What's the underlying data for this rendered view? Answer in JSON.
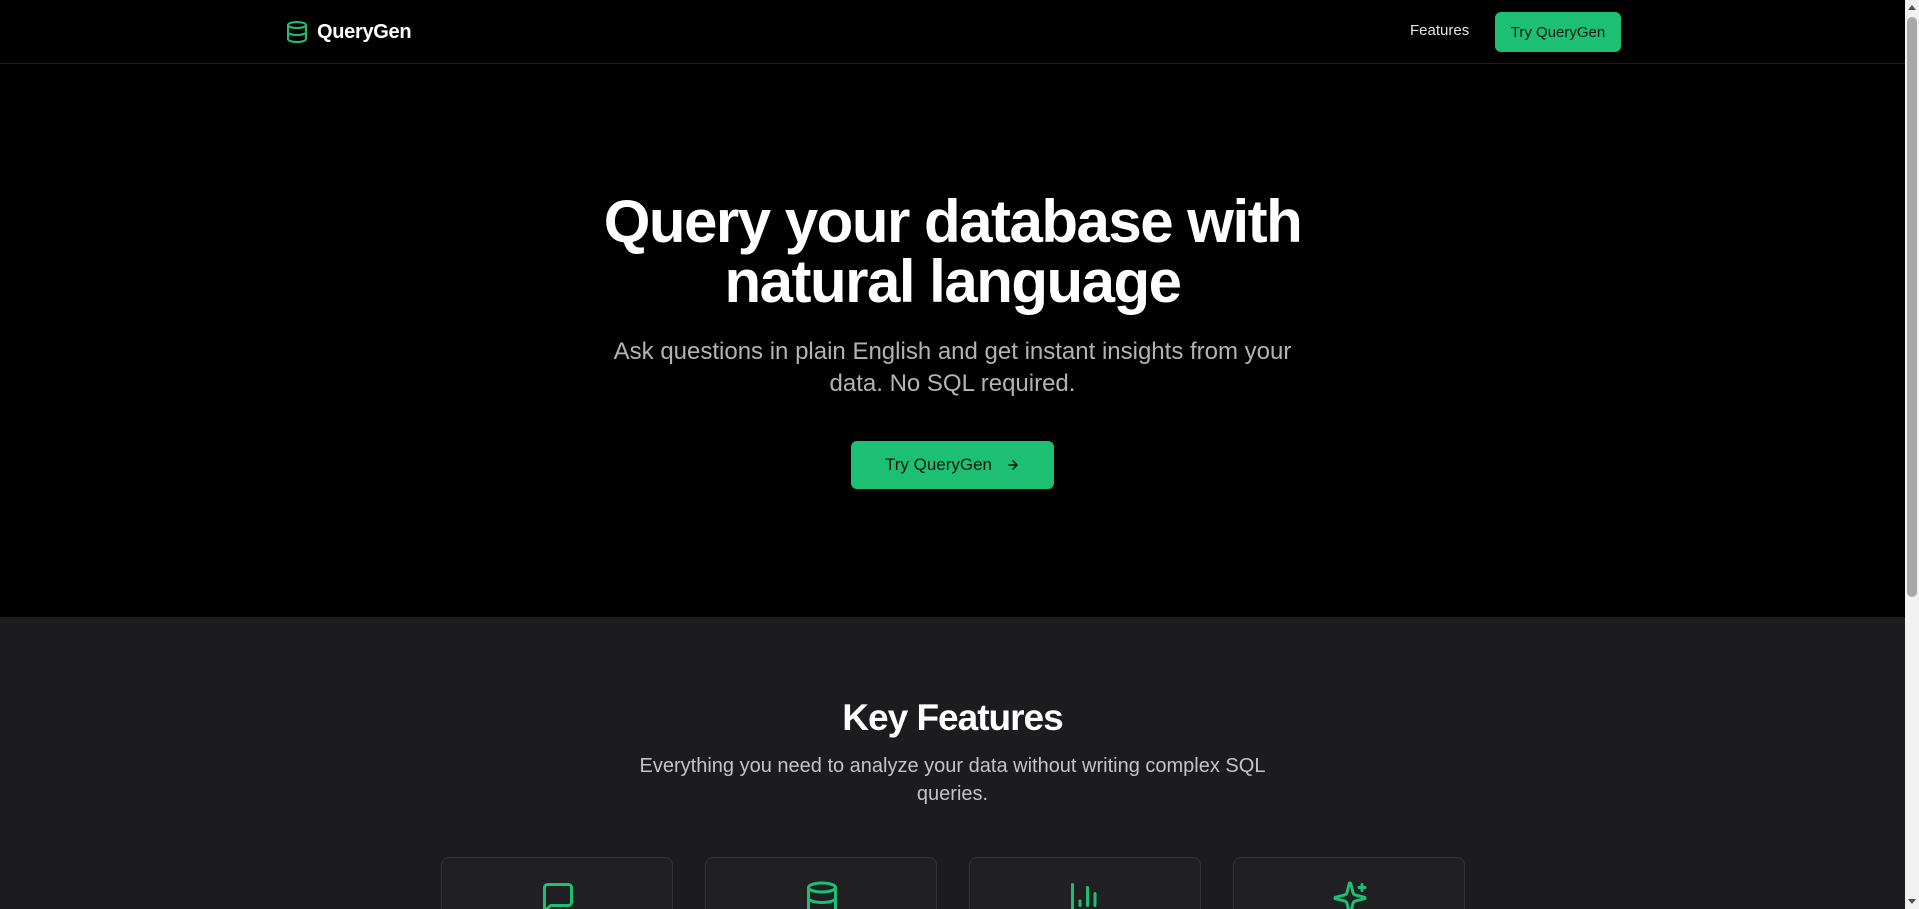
{
  "header": {
    "brand": "QueryGen",
    "nav_features": "Features",
    "nav_cta": "Try QueryGen"
  },
  "hero": {
    "title_line1": "Query your database with",
    "title_line2": "natural language",
    "subtitle_line1": "Ask questions in plain English and get instant insights from your",
    "subtitle_line2": "data. No SQL required.",
    "cta_label": "Try QueryGen",
    "cta_icon": "arrow-right-icon"
  },
  "features": {
    "title": "Key Features",
    "subtitle_line1": "Everything you need to analyze your data without writing complex SQL",
    "subtitle_line2": "queries.",
    "cards": [
      {
        "icon": "message-square-icon"
      },
      {
        "icon": "database-icon"
      },
      {
        "icon": "bar-chart-icon"
      },
      {
        "icon": "sparkles-icon"
      }
    ]
  },
  "colors": {
    "accent": "#1dbf73",
    "background": "#000000",
    "section_background": "#1c1c1e"
  }
}
